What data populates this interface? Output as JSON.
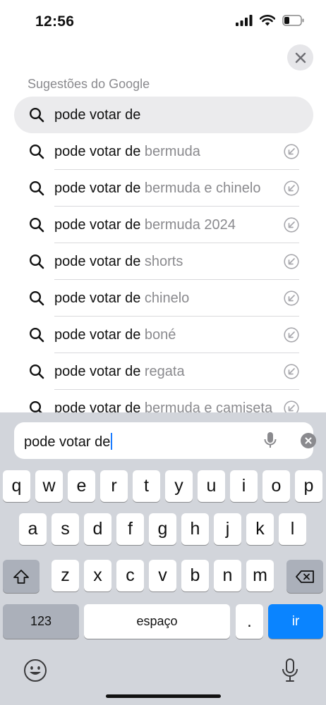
{
  "status": {
    "time": "12:56"
  },
  "section_title": "Sugestões do Google",
  "query": "pode votar de",
  "suggestions": [
    {
      "base": "pode votar de",
      "rest": " bermuda"
    },
    {
      "base": "pode votar de",
      "rest": " bermuda e chinelo"
    },
    {
      "base": "pode votar de",
      "rest": " bermuda 2024"
    },
    {
      "base": "pode votar de",
      "rest": " shorts"
    },
    {
      "base": "pode votar de",
      "rest": " chinelo"
    },
    {
      "base": "pode votar de",
      "rest": " boné"
    },
    {
      "base": "pode votar de",
      "rest": " regata"
    },
    {
      "base": "pode votar de",
      "rest": " bermuda e camiseta"
    }
  ],
  "keyboard": {
    "row1": [
      "q",
      "w",
      "e",
      "r",
      "t",
      "y",
      "u",
      "i",
      "o",
      "p"
    ],
    "row2": [
      "a",
      "s",
      "d",
      "f",
      "g",
      "h",
      "j",
      "k",
      "l"
    ],
    "row3": [
      "z",
      "x",
      "c",
      "v",
      "b",
      "n",
      "m"
    ],
    "numbers_label": "123",
    "space_label": "espaço",
    "period_label": ".",
    "go_label": "ir"
  },
  "colors": {
    "accent": "#0a84ff",
    "secondary_text": "#8a8a8e",
    "keyboard_bg": "#d2d5db"
  }
}
